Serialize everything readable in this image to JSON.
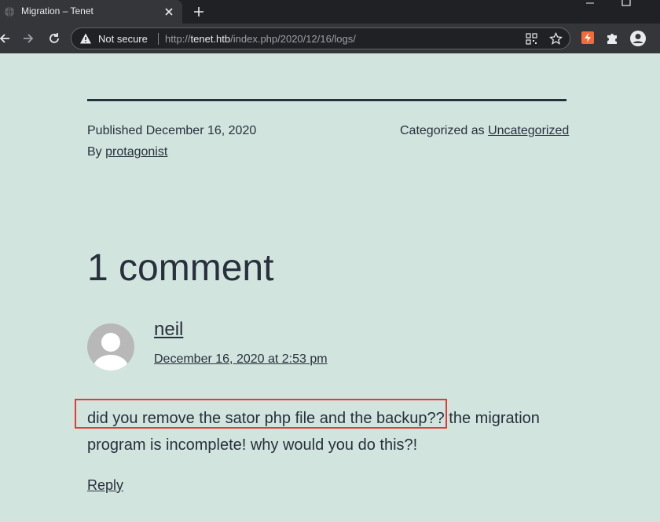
{
  "browser": {
    "tab_title": "Migration – Tenet",
    "security_label": "Not secure",
    "url_scheme": "http://",
    "url_host": "tenet.htb",
    "url_path": "/index.php/2020/12/16/logs/",
    "icons": [
      "globe-icon",
      "close-icon",
      "plus-icon",
      "minimize-icon",
      "maximize-icon",
      "back-icon",
      "forward-icon",
      "reload-icon",
      "warning-icon",
      "qr-code-icon",
      "star-icon",
      "extension-icon",
      "puzzle-icon",
      "profile-icon"
    ]
  },
  "post_meta": {
    "published_label": "Published December 16, 2020",
    "by_label": "By",
    "author": "protagonist",
    "categorized_label": "Categorized as",
    "category": "Uncategorized"
  },
  "comments": {
    "title": "1 comment",
    "items": [
      {
        "author": "neil",
        "date": "December 16, 2020 at 2:53 pm",
        "text": "did you remove the sator php file and the backup?? the migration program is incomplete! why would you do this?!",
        "reply_label": "Reply"
      }
    ]
  },
  "colors": {
    "page_background": "#d1e4dd",
    "text": "#28303d",
    "highlight_border": "#e53935",
    "chrome_dark": "#202124",
    "chrome_tab": "#35363a"
  }
}
